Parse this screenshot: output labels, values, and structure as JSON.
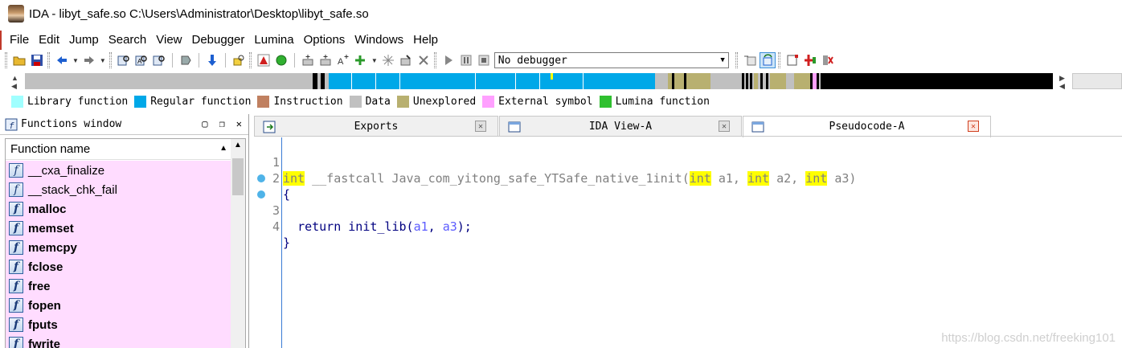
{
  "window": {
    "title": "IDA - libyt_safe.so C:\\Users\\Administrator\\Desktop\\libyt_safe.so"
  },
  "menu": [
    "File",
    "Edit",
    "Jump",
    "Search",
    "View",
    "Debugger",
    "Lumina",
    "Options",
    "Windows",
    "Help"
  ],
  "toolbar": {
    "debugger_selected": "No debugger"
  },
  "legend": [
    {
      "label": "Library function",
      "color": "#a0ffff"
    },
    {
      "label": "Regular function",
      "color": "#00a8e8"
    },
    {
      "label": "Instruction",
      "color": "#c08060"
    },
    {
      "label": "Data",
      "color": "#c0c0c0"
    },
    {
      "label": "Unexplored",
      "color": "#b8b070"
    },
    {
      "label": "External symbol",
      "color": "#ffa0ff"
    },
    {
      "label": "Lumina function",
      "color": "#30c030"
    }
  ],
  "functions_window": {
    "title": "Functions window",
    "column": "Function name",
    "items": [
      "__cxa_finalize",
      "__stack_chk_fail",
      "malloc",
      "memset",
      "memcpy",
      "fclose",
      "free",
      "fopen",
      "fputs",
      "fwrite"
    ]
  },
  "tabs": [
    {
      "label": "Exports",
      "active": false
    },
    {
      "label": "IDA View-A",
      "active": false
    },
    {
      "label": "Pseudocode-A",
      "active": true
    }
  ],
  "pseudocode": {
    "line_numbers": [
      "1",
      "2",
      "3",
      "4"
    ],
    "l1": {
      "ret_type": "int",
      "conv": " __fastcall ",
      "fname": "Java_com_yitong_safe_YTSafe_native_1init",
      "open": "(",
      "t1": "int",
      "a1": " a1, ",
      "t2": "int",
      "a2": " a2, ",
      "t3": "int",
      "a3": " a3)"
    },
    "l2": "{",
    "l3": {
      "indent": "  ",
      "kw": "return",
      "call": " init_lib(",
      "v1": "a1",
      "comma": ", ",
      "v2": "a3",
      "end": ");"
    },
    "l4": "}"
  },
  "watermark": "https://blog.csdn.net/freeking101"
}
